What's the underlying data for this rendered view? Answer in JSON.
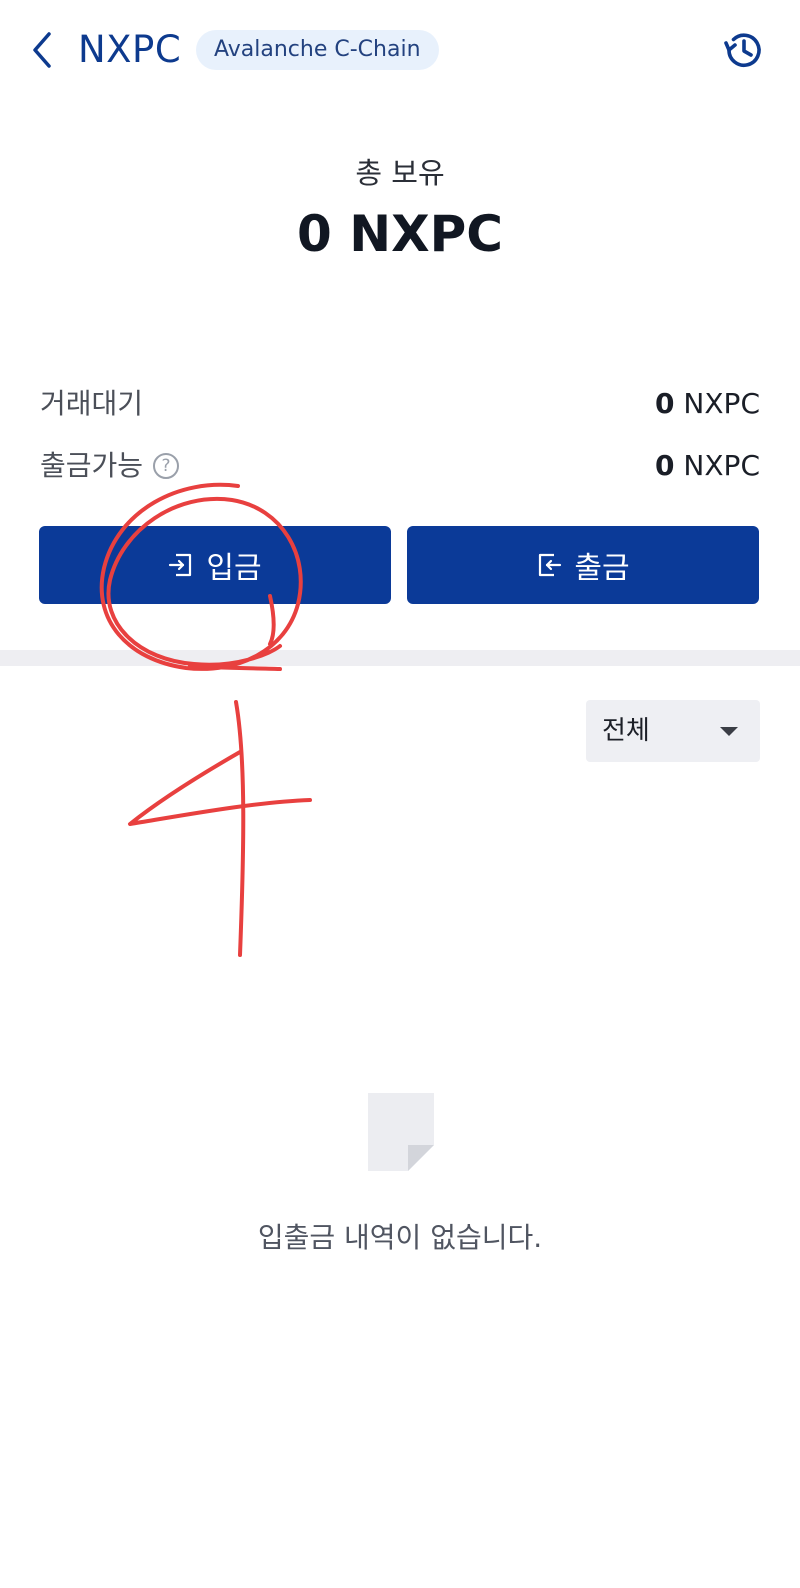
{
  "header": {
    "title": "NXPC",
    "chain_badge": "Avalanche C-Chain",
    "back_icon": "chevron-left-icon",
    "history_icon": "history-icon",
    "accent_color": "#0d3a8e"
  },
  "summary": {
    "total_label": "총 보유",
    "total_value": "0 NXPC"
  },
  "balances": [
    {
      "label": "거래대기",
      "amount": "0",
      "unit": " NXPC"
    },
    {
      "label": "출금가능",
      "amount": "0",
      "unit": " NXPC",
      "help_icon": "?"
    }
  ],
  "actions": {
    "deposit_label": "입금",
    "withdraw_label": "출금",
    "button_color": "#0b3a98"
  },
  "filter": {
    "selected": "전체"
  },
  "empty_state": {
    "icon": "document-icon",
    "message": "입출금 내역이 없습니다."
  },
  "annotation": {
    "color": "#e8403f",
    "handwritten_text": "4"
  }
}
